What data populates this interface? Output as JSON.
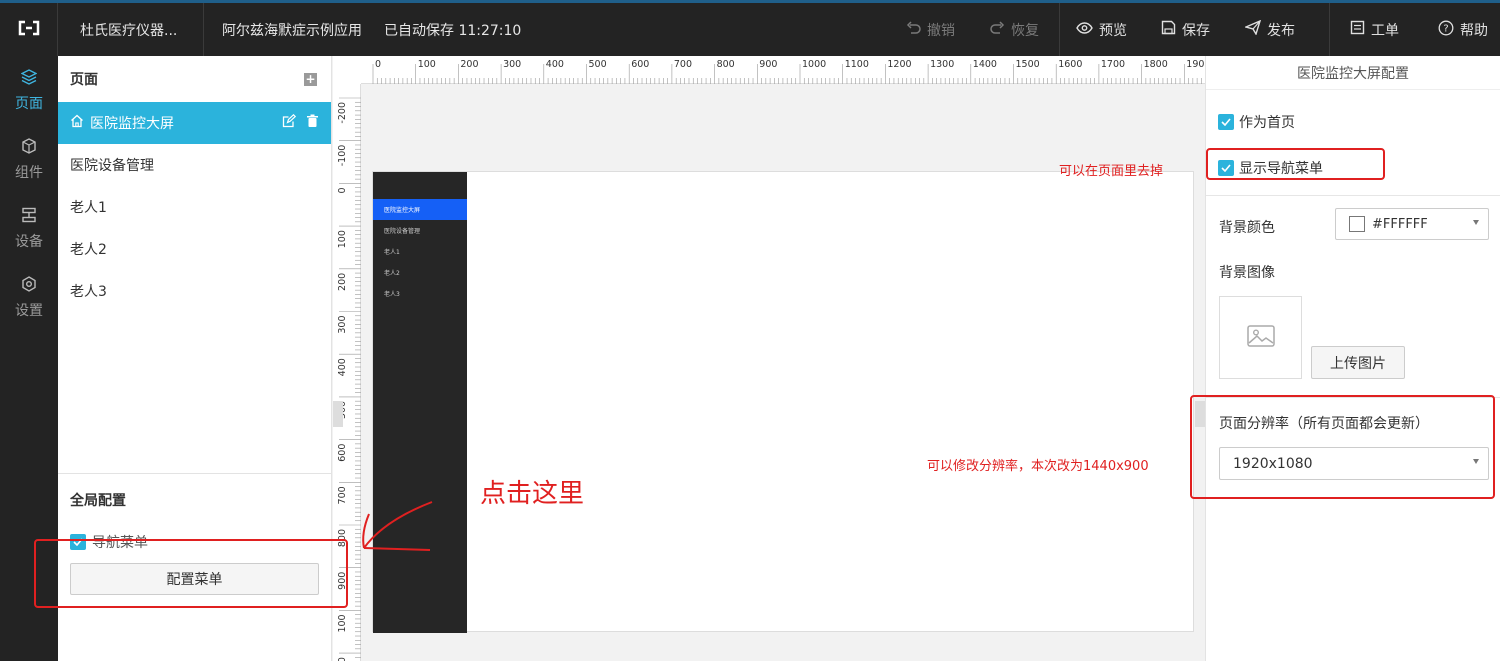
{
  "topbar": {
    "project_name": "杜氏医疗仪器...",
    "app_title": "阿尔兹海默症示例应用",
    "autosave_status": "已自动保存 11:27:10",
    "undo_label": "撤销",
    "redo_label": "恢复",
    "preview_label": "预览",
    "save_label": "保存",
    "publish_label": "发布",
    "ticket_label": "工单",
    "help_label": "帮助"
  },
  "rail": {
    "items": [
      {
        "label": "页面",
        "icon": "layers-icon"
      },
      {
        "label": "组件",
        "icon": "cube-icon"
      },
      {
        "label": "设备",
        "icon": "server-icon"
      },
      {
        "label": "设置",
        "icon": "settings-icon"
      }
    ]
  },
  "pages_panel": {
    "title": "页面",
    "pages": [
      "医院监控大屏",
      "医院设备管理",
      "老人1",
      "老人2",
      "老人3"
    ],
    "global_title": "全局配置",
    "nav_menu_label": "导航菜单",
    "config_menu_button": "配置菜单"
  },
  "ruler": {
    "top_ticks": [
      "0",
      "100",
      "200",
      "300",
      "400",
      "500",
      "600",
      "700",
      "800",
      "900",
      "1000",
      "1100",
      "1200",
      "1300",
      "1400",
      "1500",
      "1600",
      "1700",
      "1800",
      "190"
    ],
    "left_ticks": [
      "-200",
      "-100",
      "0",
      "100",
      "200",
      "300",
      "400",
      "500",
      "600",
      "700",
      "800",
      "900",
      "100",
      "100"
    ]
  },
  "canvas": {
    "nav_items": [
      "医院监控大屏",
      "医院设备管理",
      "老人1",
      "老人2",
      "老人3"
    ]
  },
  "right_panel": {
    "title": "医院监控大屏配置",
    "homepage_label": "作为首页",
    "show_nav_label": "显示导航菜单",
    "bg_color_label": "背景颜色",
    "bg_color_value": "#FFFFFF",
    "bg_image_label": "背景图像",
    "upload_button": "上传图片",
    "resolution_label": "页面分辨率（所有页面都会更新）",
    "resolution_value": "1920x1080"
  },
  "annotations": {
    "remove_in_page": "可以在页面里去掉",
    "click_here": "点击这里",
    "resolution_note": "可以修改分辨率，本次改为1440x900"
  },
  "colors": {
    "accent": "#2bb3dc",
    "annotation_red": "#e02020",
    "dark_bar": "#232323"
  }
}
